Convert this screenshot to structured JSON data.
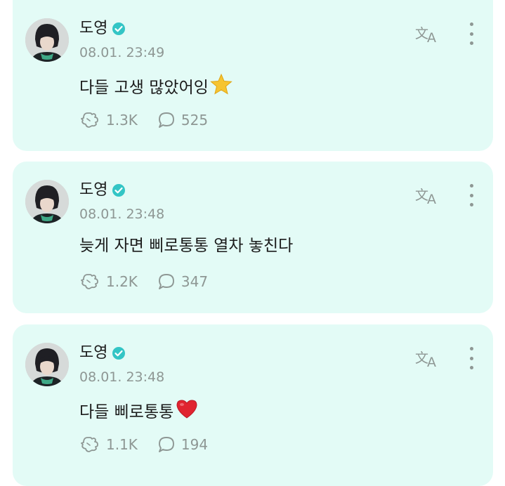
{
  "posts": [
    {
      "author": "도영",
      "timestamp": "08.01. 23:49",
      "text": "다들 고생 많았어잉",
      "emoji": "star-emoji",
      "likes": "1.3K",
      "comments": "525"
    },
    {
      "author": "도영",
      "timestamp": "08.01. 23:48",
      "text": "늦게 자면 삐로통통 열차 놓친다",
      "emoji": "",
      "likes": "1.2K",
      "comments": "347"
    },
    {
      "author": "도영",
      "timestamp": "08.01. 23:48",
      "text": "다들 삐로통통",
      "emoji": "red-heart-emoji",
      "likes": "1.1K",
      "comments": "194"
    }
  ],
  "colors": {
    "card_background": "#e3fbf6",
    "verified_badge": "#33c5c5",
    "muted_text": "#8e9794"
  },
  "icons": [
    "verified-badge-icon",
    "translate-icon",
    "more-options-icon",
    "like-icon",
    "comment-icon"
  ]
}
